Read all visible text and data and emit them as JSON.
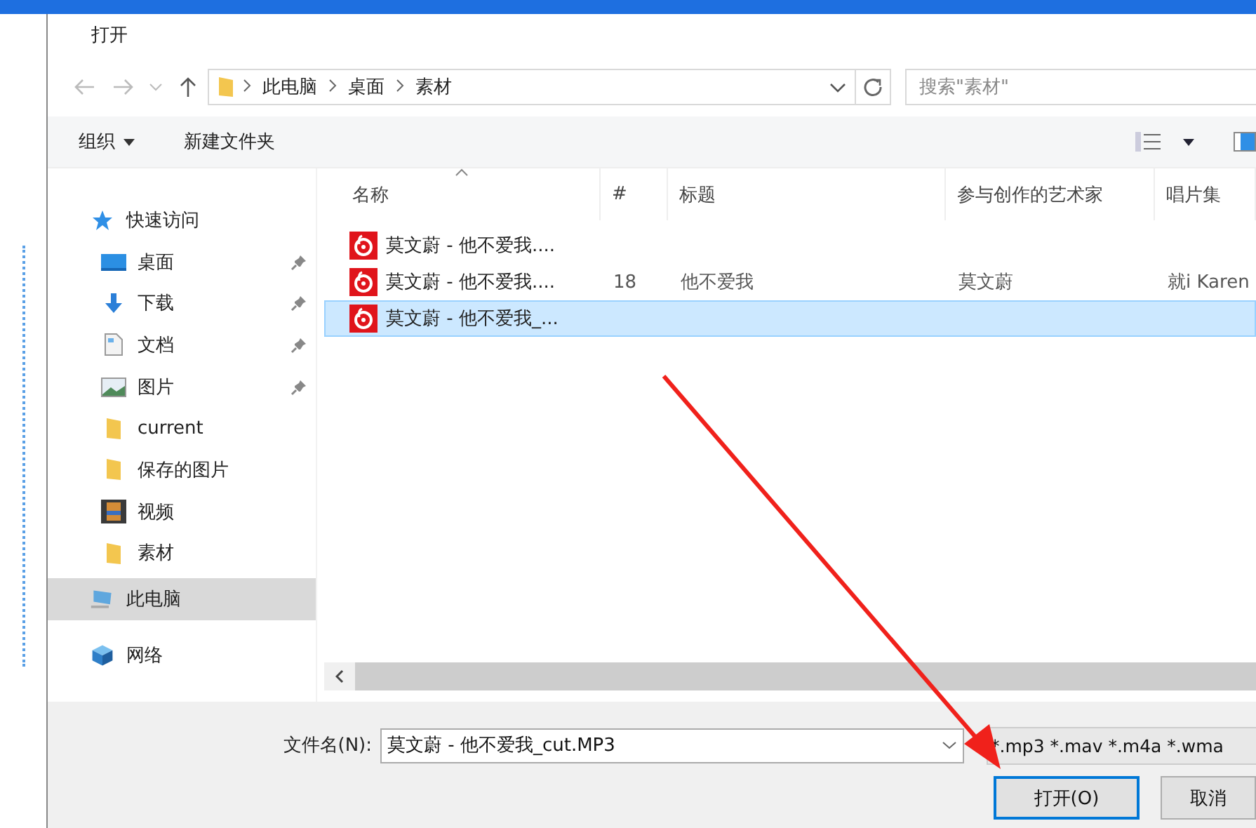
{
  "window": {
    "title": "打开"
  },
  "address": {
    "path": [
      "此电脑",
      "桌面",
      "素材"
    ],
    "search_placeholder": "搜索\"素材\""
  },
  "toolbar": {
    "organize": "组织",
    "new_folder": "新建文件夹"
  },
  "sidebar": {
    "items": [
      {
        "label": "快速访问",
        "kind": "star",
        "selected": false,
        "children": [
          {
            "label": "桌面",
            "kind": "desktop",
            "pinned": true,
            "selected": false
          },
          {
            "label": "下载",
            "kind": "download",
            "pinned": true,
            "selected": false
          },
          {
            "label": "文档",
            "kind": "document",
            "pinned": true,
            "selected": false
          },
          {
            "label": "图片",
            "kind": "picture",
            "pinned": true,
            "selected": false
          },
          {
            "label": "current",
            "kind": "folder",
            "pinned": false,
            "selected": false
          },
          {
            "label": "保存的图片",
            "kind": "folder",
            "pinned": false,
            "selected": false
          },
          {
            "label": "视频",
            "kind": "video",
            "pinned": false,
            "selected": false
          },
          {
            "label": "素材",
            "kind": "folder",
            "pinned": false,
            "selected": false
          }
        ]
      },
      {
        "label": "此电脑",
        "kind": "computer",
        "selected": true
      },
      {
        "label": "网络",
        "kind": "network",
        "selected": false
      }
    ]
  },
  "table": {
    "columns": [
      {
        "label": "名称",
        "sorted": true
      },
      {
        "label": "#",
        "sorted": false
      },
      {
        "label": "标题",
        "sorted": false
      },
      {
        "label": "参与创作的艺术家",
        "sorted": false
      },
      {
        "label": "唱片集",
        "sorted": false
      }
    ],
    "rows": [
      {
        "cells": [
          "莫文蔚 - 他不爱我...."
        ],
        "selected": false
      },
      {
        "cells": [
          "莫文蔚 - 他不爱我....",
          "18",
          "他不爱我",
          "莫文蔚",
          "就i Karen"
        ],
        "selected": false
      },
      {
        "cells": [
          "莫文蔚 - 他不爱我_..."
        ],
        "selected": true
      }
    ]
  },
  "file_name": {
    "label": "文件名(N):",
    "value": "莫文蔚 - 他不爱我_cut.MP3"
  },
  "file_type": {
    "value": "*.mp3 *.mav *.m4a *.wma"
  },
  "buttons": [
    {
      "label": "打开(O)",
      "kind": "primary"
    },
    {
      "label": "取消",
      "kind": "normal"
    }
  ]
}
